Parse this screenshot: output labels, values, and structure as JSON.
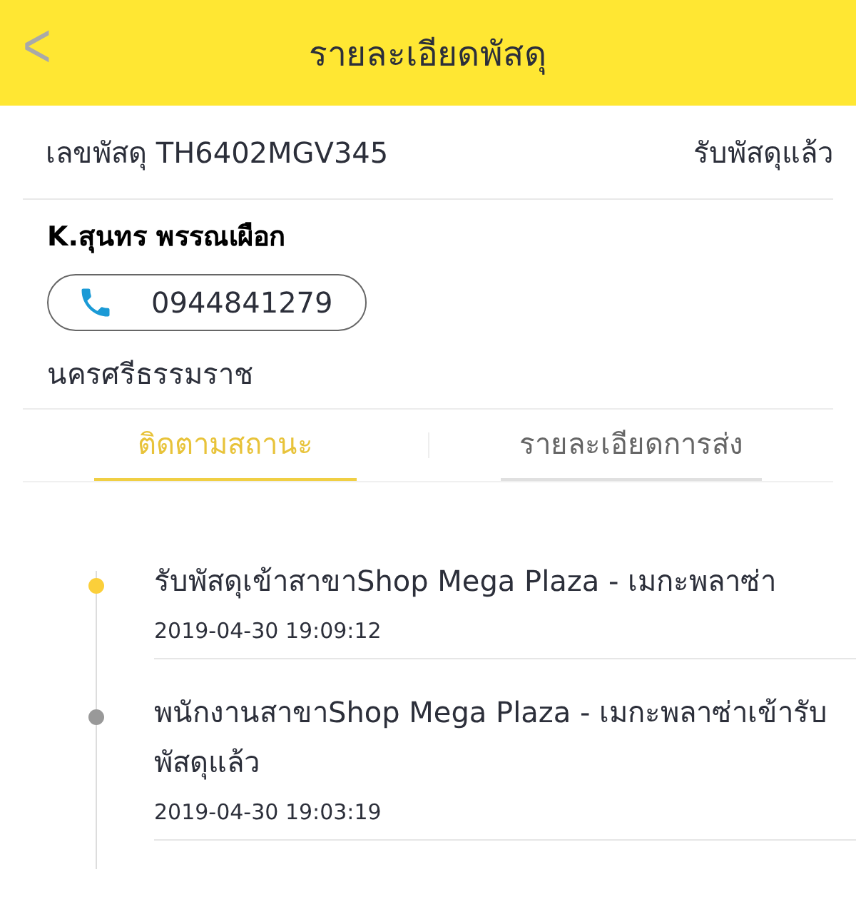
{
  "header": {
    "back": "<",
    "title": "รายละเอียดพัสดุ"
  },
  "parcel": {
    "number": "เลขพัสดุ TH6402MGV345",
    "status": "รับพัสดุแล้ว"
  },
  "recipient": {
    "name": "K.สุนทร พรรณเผือก",
    "phone": "0944841279",
    "province": "นครศรีธรรมราช"
  },
  "tabs": [
    {
      "label": "ติดตามสถานะ",
      "selected": true
    },
    {
      "label": "รายละเอียดการส่ง",
      "selected": false
    }
  ],
  "events": [
    {
      "text": "รับพัสดุเข้าสาขาShop Mega Plaza - เมกะพลาซ่า",
      "time": "2019-04-30 19:09:12",
      "current": true
    },
    {
      "text": "พนักงานสาขาShop Mega Plaza - เมกะพลาซ่าเข้ารับพัสดุแล้ว",
      "time": "2019-04-30 19:03:19",
      "current": false
    }
  ]
}
